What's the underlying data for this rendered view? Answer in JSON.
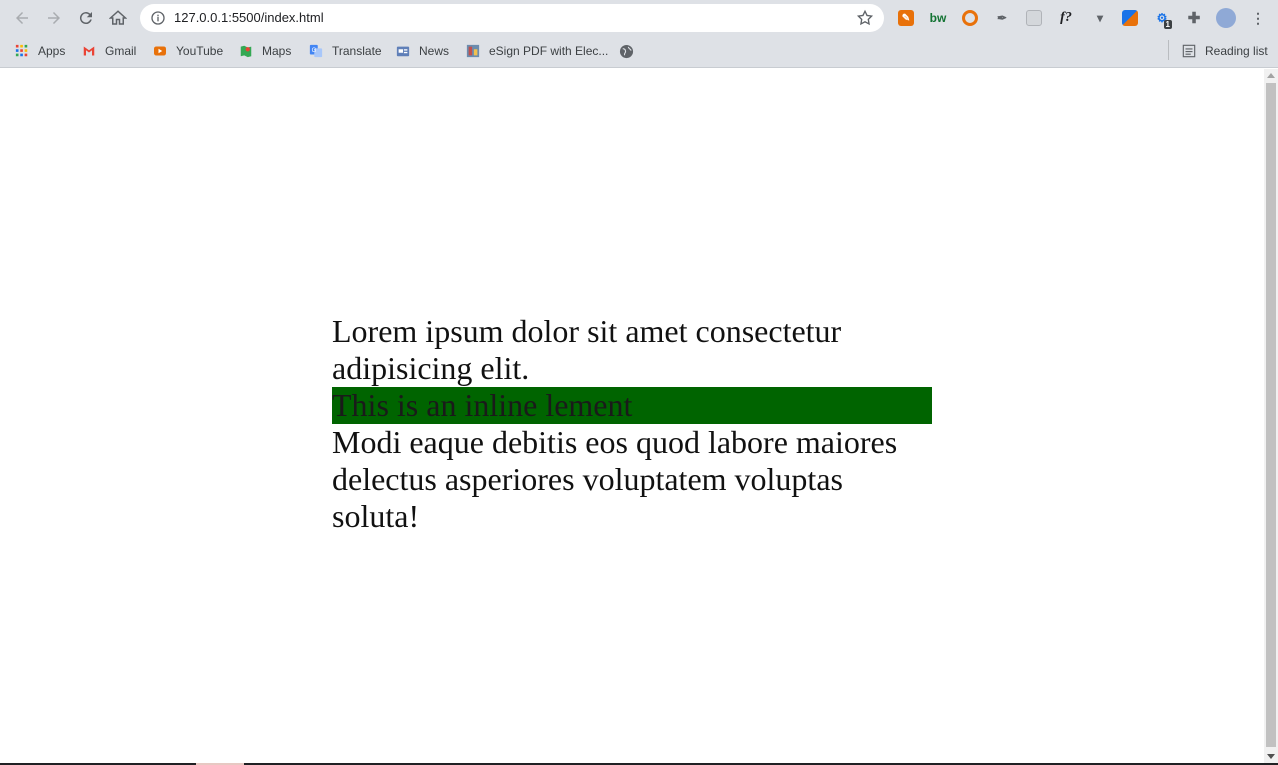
{
  "browser": {
    "url": "127.0.0.1:5500/index.html",
    "bookmarks": [
      {
        "label": "Apps",
        "icon": "apps-grid-icon"
      },
      {
        "label": "Gmail",
        "icon": "gmail-icon"
      },
      {
        "label": "YouTube",
        "icon": "youtube-icon"
      },
      {
        "label": "Maps",
        "icon": "maps-icon"
      },
      {
        "label": "Translate",
        "icon": "translate-icon"
      },
      {
        "label": "News",
        "icon": "news-icon"
      },
      {
        "label": "eSign PDF with Elec...",
        "icon": "esign-icon"
      }
    ],
    "reading_list": "Reading list",
    "extensions": [
      "edit-ext-icon",
      "bw-ext-icon",
      "eye-ext-icon",
      "dropper-ext-icon",
      "grid-ext-icon",
      "font-ext-icon",
      "dropdown-ext-icon",
      "flag-ext-icon",
      "badge-ext-icon",
      "puzzle-icon",
      "avatar"
    ],
    "ext_text": {
      "bw": "bw",
      "font": "f?",
      "badge": "1"
    }
  },
  "page": {
    "paragraph_1": "Lorem ipsum dolor sit amet consectetur adipisicing elit.",
    "inline_text": "This is an inline lement",
    "paragraph_2": "Modi eaque debitis eos quod labore maiores delectus asperiores voluptatem voluptas soluta!",
    "highlight_color": "#006400"
  }
}
